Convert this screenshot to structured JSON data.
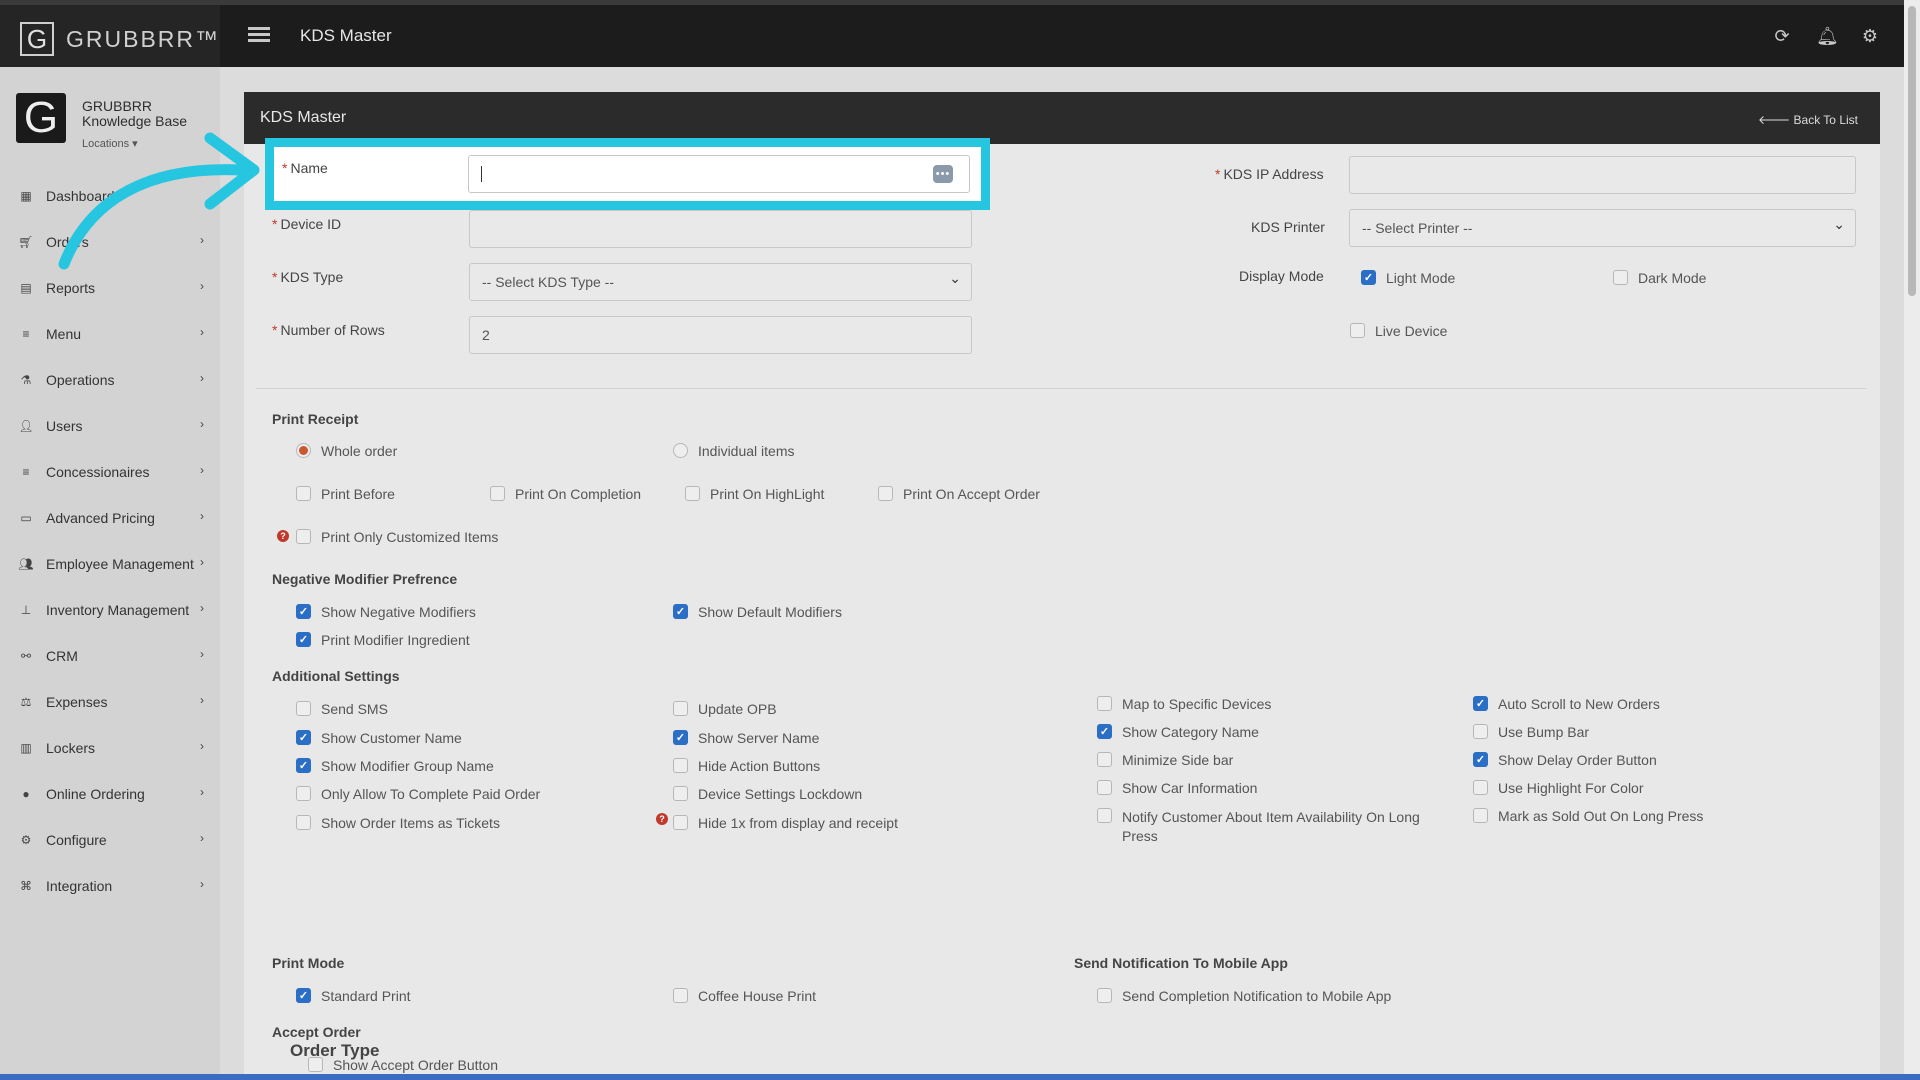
{
  "app": {
    "brand": "GRUBBRR™",
    "logo_letter": "G",
    "top_title": "KDS Master"
  },
  "profile": {
    "avatar_letter": "G",
    "name_line1": "GRUBBRR",
    "name_line2": "Knowledge Base",
    "locations_label": "Locations ▾"
  },
  "sidebar": {
    "items": [
      {
        "label": "Dashboard",
        "icon": "dashboard-icon"
      },
      {
        "label": "Orders",
        "icon": "cart-icon"
      },
      {
        "label": "Reports",
        "icon": "report-icon"
      },
      {
        "label": "Menu",
        "icon": "list-icon"
      },
      {
        "label": "Operations",
        "icon": "flask-icon"
      },
      {
        "label": "Users",
        "icon": "user-add-icon"
      },
      {
        "label": "Concessionaires",
        "icon": "list-icon"
      },
      {
        "label": "Advanced Pricing",
        "icon": "money-icon"
      },
      {
        "label": "Employee Management",
        "icon": "users-icon"
      },
      {
        "label": "Inventory Management",
        "icon": "sitemap-icon"
      },
      {
        "label": "CRM",
        "icon": "link-icon"
      },
      {
        "label": "Expenses",
        "icon": "balance-icon"
      },
      {
        "label": "Lockers",
        "icon": "lockers-icon"
      },
      {
        "label": "Online Ordering",
        "icon": "globe-icon"
      },
      {
        "label": "Configure",
        "icon": "gear-icon"
      },
      {
        "label": "Integration",
        "icon": "integration-icon"
      }
    ]
  },
  "panel": {
    "title": "KDS Master",
    "back_label": "Back To List"
  },
  "form": {
    "name_label": "Name",
    "name_value": "",
    "device_id_label": "Device ID",
    "kds_type_label": "KDS Type",
    "kds_type_value": "-- Select KDS Type --",
    "rows_label": "Number of Rows",
    "rows_value": "2",
    "ip_label": "KDS IP Address",
    "printer_label": "KDS Printer",
    "printer_value": "-- Select Printer --",
    "display_mode_label": "Display Mode",
    "light_mode": "Light Mode",
    "dark_mode": "Dark Mode",
    "live_device": "Live Device"
  },
  "print_receipt": {
    "title": "Print Receipt",
    "whole_order": "Whole order",
    "individual_items": "Individual items",
    "print_before": "Print Before",
    "print_on_completion": "Print On Completion",
    "print_on_highlight": "Print On HighLight",
    "print_on_accept": "Print On Accept Order",
    "print_only_customized": "Print Only Customized Items"
  },
  "negative_modifier": {
    "title": "Negative Modifier Prefrence",
    "show_negative": "Show Negative Modifiers",
    "show_default": "Show Default Modifiers",
    "print_ingredient": "Print Modifier Ingredient"
  },
  "additional": {
    "title": "Additional Settings",
    "send_sms": "Send SMS",
    "update_opb": "Update OPB",
    "map_devices": "Map to Specific Devices",
    "auto_scroll": "Auto Scroll to New Orders",
    "show_customer": "Show Customer Name",
    "show_server": "Show Server Name",
    "show_category": "Show Category Name",
    "use_bump": "Use Bump Bar",
    "show_mod_group": "Show Modifier Group Name",
    "hide_action": "Hide Action Buttons",
    "minimize_side": "Minimize Side bar",
    "show_delay": "Show Delay Order Button",
    "only_allow": "Only Allow To Complete Paid Order",
    "device_lockdown": "Device Settings Lockdown",
    "show_car": "Show Car Information",
    "use_highlight": "Use Highlight For Color",
    "show_tickets": "Show Order Items as Tickets",
    "hide_1x": "Hide 1x from display and receipt",
    "notify_line1": "Notify Customer About Item Availability On Long",
    "notify_line2": "Press",
    "mark_sold_out": "Mark as Sold Out On Long Press"
  },
  "print_mode": {
    "title": "Print Mode",
    "standard": "Standard Print",
    "coffee": "Coffee House Print"
  },
  "notification": {
    "title": "Send Notification To Mobile App",
    "completion": "Send Completion Notification to Mobile App"
  },
  "accept_order": {
    "title": "Accept Order",
    "show_button": "Show Accept Order Button"
  },
  "order_type": {
    "title": "Order Type"
  },
  "colors": {
    "accent": "#27c6e0",
    "checkbox": "#2a6ec5",
    "topbar": "#1c1c1c"
  }
}
